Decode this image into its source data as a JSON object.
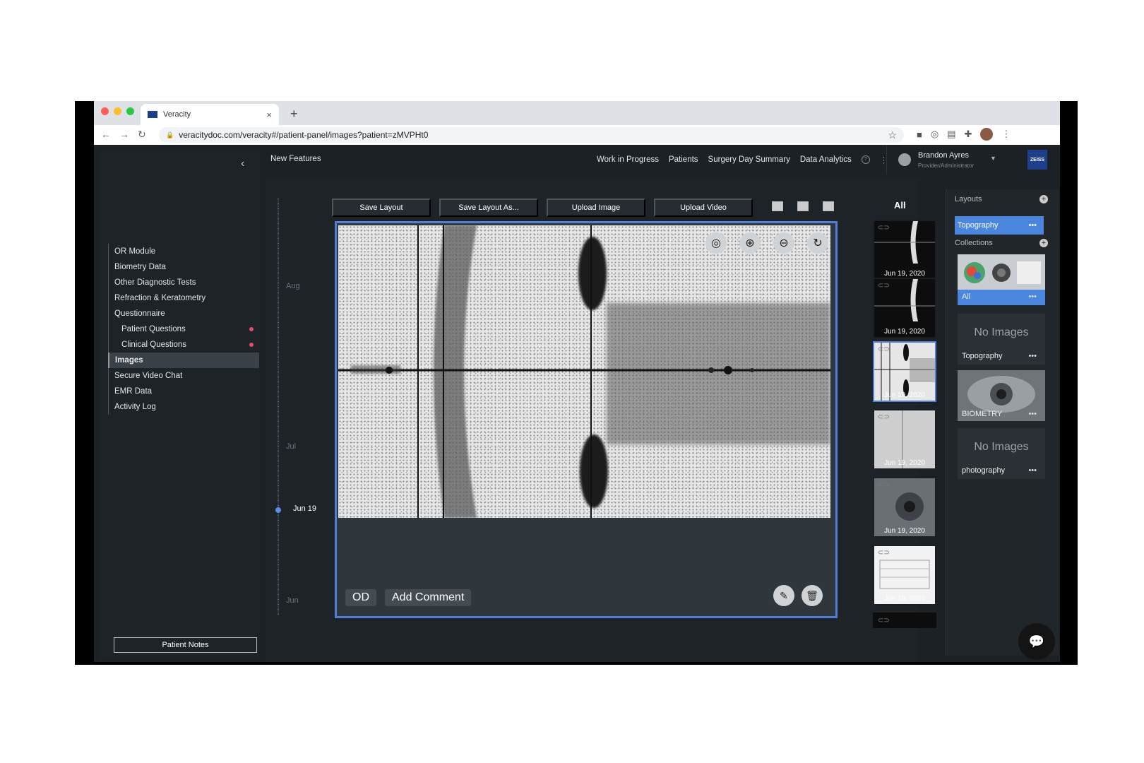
{
  "browser": {
    "tab_title": "Veracity",
    "url": "veracitydoc.com/veracity#/patient-panel/images?patient=zMVPHt0",
    "icons": [
      "back-icon",
      "forward-icon",
      "reload-icon",
      "lock-icon",
      "star-icon",
      "extension-icon",
      "avatar"
    ]
  },
  "sidebar": {
    "items": [
      {
        "label": "OR Module"
      },
      {
        "label": "Biometry Data"
      },
      {
        "label": "Other Diagnostic Tests"
      },
      {
        "label": "Refraction & Keratometry"
      },
      {
        "label": "Questionnaire"
      },
      {
        "label": "Patient Questions"
      },
      {
        "label": "Clinical Questions"
      },
      {
        "label": "Images"
      },
      {
        "label": "Secure Video Chat"
      },
      {
        "label": "EMR Data"
      },
      {
        "label": "Activity Log"
      }
    ],
    "patient_notes": "Patient Notes"
  },
  "topnav": {
    "new_features": "New Features",
    "links": [
      "Work in Progress",
      "Patients",
      "Surgery Day Summary",
      "Data Analytics"
    ],
    "user_name": "Brandon Ayres",
    "user_role": "Provider/Administrator",
    "brand": "ZEISS"
  },
  "toolbar": {
    "buttons": [
      "Save Layout",
      "Save Layout As...",
      "Upload Image",
      "Upload Video"
    ]
  },
  "timeline": {
    "labels": [
      "Aug",
      "Jul",
      "Jun"
    ],
    "selected": "Jun 19"
  },
  "viewer": {
    "eye_label": "OD",
    "comment_label": "Add Comment"
  },
  "thumbnails": {
    "filter": "All",
    "dates": [
      "Jun 19, 2020",
      "Jun 19, 2020",
      "Jun 19, 2020",
      "Jun 19, 2020",
      "Jun 19, 2020",
      "Jun 19, 2020"
    ]
  },
  "right_panel": {
    "layouts_title": "Layouts",
    "layout_selected": "Topography",
    "collections_title": "Collections",
    "collections": [
      {
        "name": "All"
      },
      {
        "name": "Topography",
        "empty_text": "No Images"
      },
      {
        "name": "BIOMETRY"
      },
      {
        "name": "photography",
        "empty_text": "No Images"
      }
    ],
    "more": "•••"
  },
  "colors": {
    "accent": "#4a86de",
    "background": "#1c2126",
    "notification_dot": "#e64b6a"
  }
}
